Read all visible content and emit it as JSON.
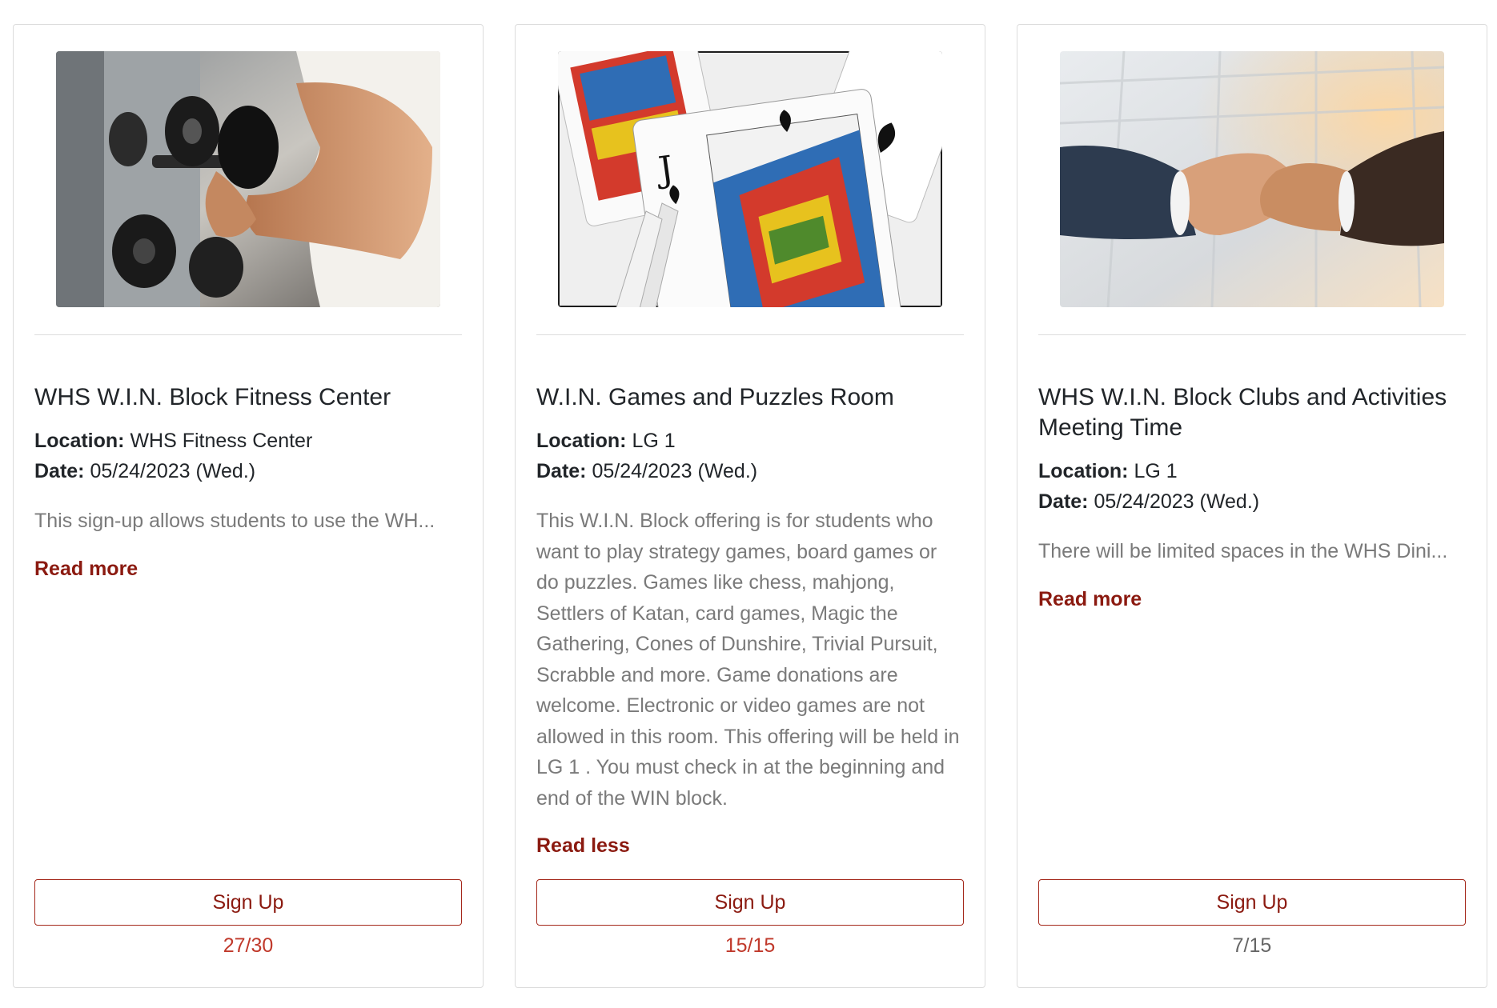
{
  "colors": {
    "accent": "#8b1a10",
    "button_border": "#a4281b",
    "capacity_full": "#c0392b",
    "capacity_open": "#666666",
    "description_text": "#7a7a7a"
  },
  "labels": {
    "location": "Location:",
    "date": "Date:"
  },
  "cards": [
    {
      "image_icon": "fitness-dumbbell-photo",
      "title": "WHS W.I.N. Block Fitness Center",
      "location": "WHS Fitness Center",
      "date": "05/24/2023 (Wed.)",
      "description": "This sign-up allows students to use the WH...",
      "toggle_label": "Read more",
      "button_label": "Sign Up",
      "capacity": "27/30"
    },
    {
      "image_icon": "playing-cards-photo",
      "title": "W.I.N. Games and Puzzles Room",
      "location": "LG 1",
      "date": "05/24/2023 (Wed.)",
      "description": "This W.I.N. Block offering is for students who want to play strategy games, board games or do puzzles. Games like chess, mahjong, Settlers of Katan, card games, Magic the Gathering, Cones of Dunshire, Trivial Pursuit, Scrabble and more. Game donations are welcome. Electronic or video games are not allowed in this room. This offering will be held in LG 1 . You must check in at the beginning and end of the WIN block.",
      "toggle_label": "Read less",
      "button_label": "Sign Up",
      "capacity": "15/15"
    },
    {
      "image_icon": "handshake-photo",
      "title": "WHS W.I.N. Block Clubs and Activities Meeting Time",
      "location": "LG 1",
      "date": "05/24/2023 (Wed.)",
      "description": "There will be limited spaces in the WHS Dini...",
      "toggle_label": "Read more",
      "button_label": "Sign Up",
      "capacity": "7/15"
    }
  ]
}
